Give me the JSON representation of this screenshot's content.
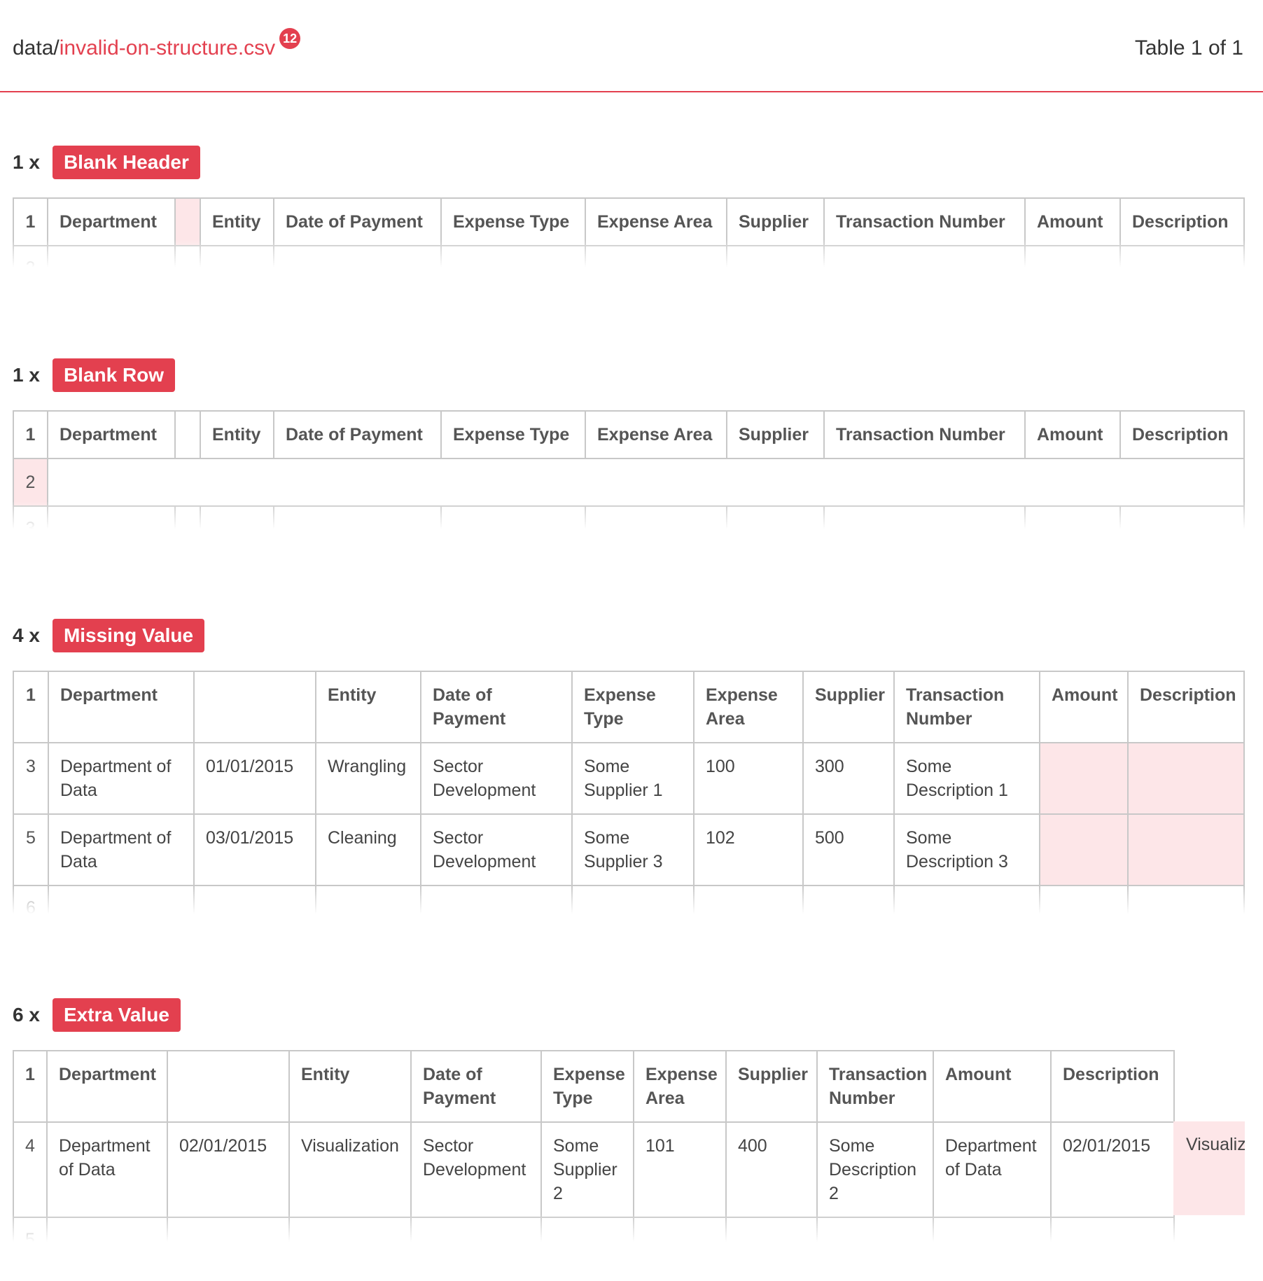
{
  "header": {
    "path_prefix": "data/",
    "file_name": "invalid-on-structure.csv",
    "error_count": "12",
    "table_count": "Table 1 of 1"
  },
  "reports": [
    {
      "count": "1 x",
      "label": "Blank Header",
      "header_row": [
        "1",
        "Department",
        "",
        "Entity",
        "Date of Payment",
        "Expense Type",
        "Expense Area",
        "Supplier",
        "Transaction Number",
        "Amount",
        "Description"
      ],
      "rows": [
        [
          "2",
          "",
          "",
          "",
          "",
          "",
          "",
          "",
          "",
          "",
          ""
        ]
      ]
    },
    {
      "count": "1 x",
      "label": "Blank Row",
      "header_row": [
        "1",
        "Department",
        "",
        "Entity",
        "Date of Payment",
        "Expense Type",
        "Expense Area",
        "Supplier",
        "Transaction Number",
        "Amount",
        "Description"
      ],
      "rows": [
        [
          "2"
        ],
        [
          "3",
          "",
          "",
          "",
          "",
          "",
          "",
          "",
          "",
          "",
          ""
        ]
      ]
    },
    {
      "count": "4 x",
      "label": "Missing Value",
      "header_row": [
        "1",
        "Department",
        "",
        "Entity",
        "Date of Payment",
        "Expense Type",
        "Expense Area",
        "Supplier",
        "Transaction Number",
        "Amount",
        "Description"
      ],
      "rows": [
        [
          "3",
          "Department of Data",
          "01/01/2015",
          "Wrangling",
          "Sector Development",
          "Some Supplier 1",
          "100",
          "300",
          "Some Description 1",
          "",
          ""
        ],
        [
          "5",
          "Department of Data",
          "03/01/2015",
          "Cleaning",
          "Sector Development",
          "Some Supplier 3",
          "102",
          "500",
          "Some Description 3",
          "",
          ""
        ],
        [
          "6",
          "",
          "",
          "",
          "",
          "",
          "",
          "",
          "",
          "",
          ""
        ]
      ]
    },
    {
      "count": "6 x",
      "label": "Extra Value",
      "header_row": [
        "1",
        "Department",
        "",
        "Entity",
        "Date of Payment",
        "Expense Type",
        "Expense Area",
        "Supplier",
        "Transaction Number",
        "Amount",
        "Description"
      ],
      "rows": [
        [
          "4",
          "Department of Data",
          "02/01/2015",
          "Visualization",
          "Sector Development",
          "Some Supplier 2",
          "101",
          "400",
          "Some Description 2",
          "Department of Data",
          "02/01/2015",
          "Visualiz"
        ],
        [
          "5",
          "",
          "",
          "",
          "",
          "",
          "",
          "",
          "",
          "",
          ""
        ]
      ]
    }
  ]
}
